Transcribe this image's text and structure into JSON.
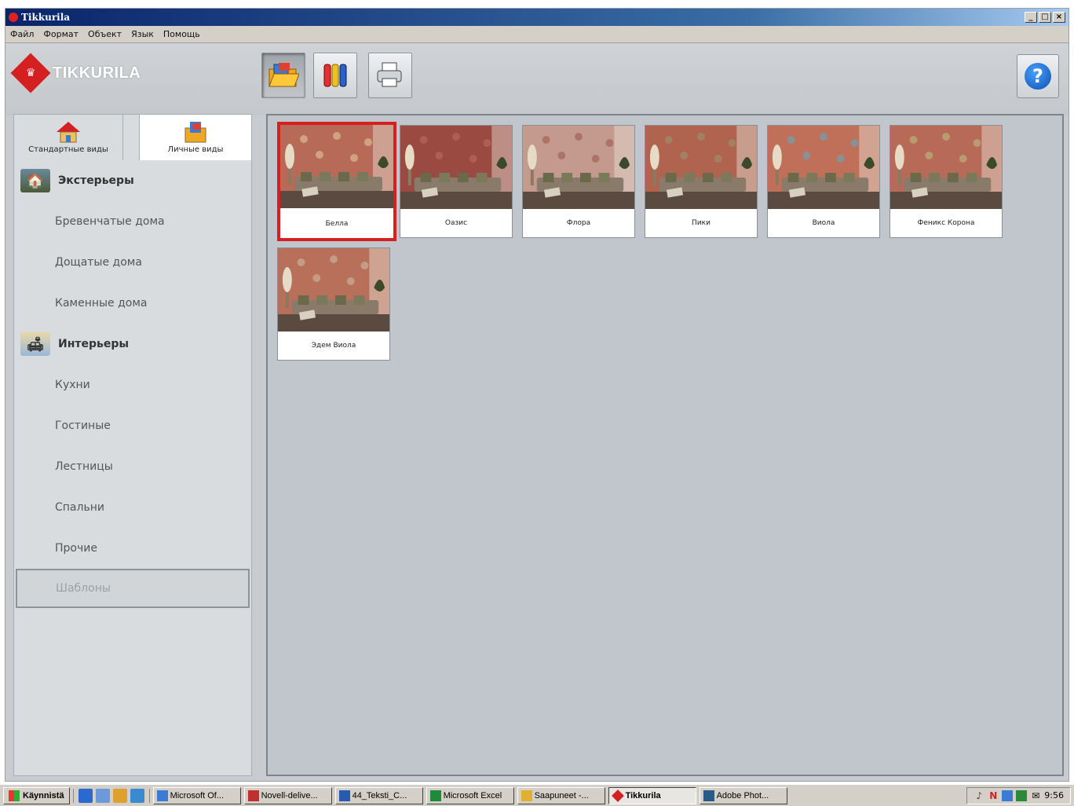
{
  "window": {
    "title": "Tikkurila",
    "controls": [
      "_",
      "□",
      "×"
    ]
  },
  "menu": [
    "Файл",
    "Формат",
    "Объект",
    "Язык",
    "Помощь"
  ],
  "brand": {
    "name": "TIKKURILA",
    "color": "#d42020"
  },
  "toolbar": {
    "help_label": "?"
  },
  "tabs": [
    {
      "label": "Стандартные виды",
      "icon": "house-icon"
    },
    {
      "label": "Личные виды",
      "icon": "personal-folder-icon"
    }
  ],
  "categories": {
    "exteriors": {
      "label": "Экстерьеры",
      "icon": "exterior-photo-icon"
    },
    "exterior_items": [
      "Бревенчатые дома",
      "Дощатые дома",
      "Каменные дома"
    ],
    "interiors": {
      "label": "Интерьеры",
      "icon": "interior-photo-icon"
    },
    "interior_items": [
      "Кухни",
      "Гостиные",
      "Лестницы",
      "Спальни",
      "Прочие"
    ],
    "templates": "Шаблоны"
  },
  "thumbnails": [
    {
      "label": "Белла",
      "wall": "#b86a58",
      "pattern": "#d8b08a"
    },
    {
      "label": "Оазис",
      "wall": "#9a4a40",
      "pattern": "#b8625a"
    },
    {
      "label": "Флора",
      "wall": "#c59a8e",
      "pattern": "#a86a5e"
    },
    {
      "label": "Пики",
      "wall": "#b06450",
      "pattern": "#9e8868"
    },
    {
      "label": "Виола",
      "wall": "#c07058",
      "pattern": "#7a9aa8"
    },
    {
      "label": "Феникс Корона",
      "wall": "#b86a58",
      "pattern": "#b8a878"
    },
    {
      "label": "Эдем Виола",
      "wall": "#b8705a",
      "pattern": "#c8a890"
    }
  ],
  "taskbar": {
    "start": "Käynnistä",
    "tasks": [
      "Microsoft Of...",
      "Novell-delive...",
      "44_Teksti_C...",
      "Microsoft Excel",
      "Saapuneet -...",
      "Tikkurila",
      "Adobe Phot..."
    ],
    "time": "9:56"
  }
}
